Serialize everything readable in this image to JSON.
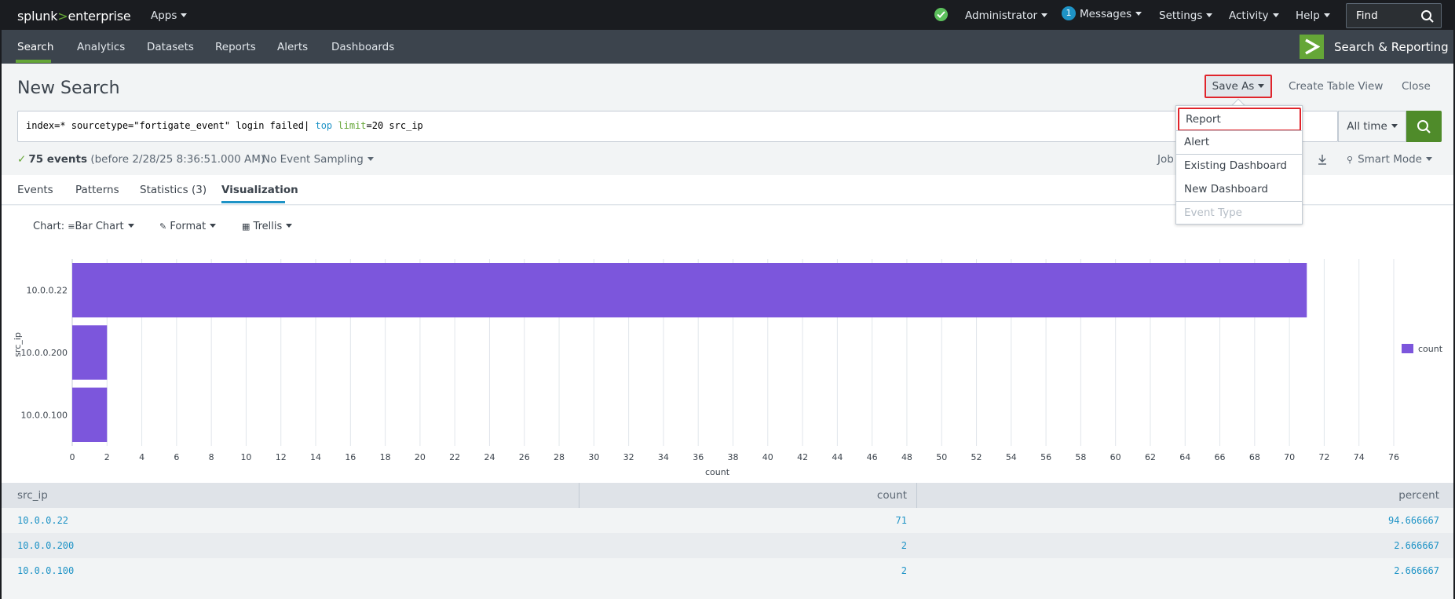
{
  "topbar": {
    "logo_splunk": "splunk",
    "logo_gt": ">",
    "logo_enterprise": "enterprise",
    "apps": "Apps",
    "admin": "Administrator",
    "messages_count": "1",
    "messages": "Messages",
    "settings": "Settings",
    "activity": "Activity",
    "help": "Help",
    "find_placeholder": "Find"
  },
  "appbar": {
    "items": [
      "Search",
      "Analytics",
      "Datasets",
      "Reports",
      "Alerts",
      "Dashboards"
    ],
    "app_title": "Search & Reporting"
  },
  "header": {
    "title": "New Search",
    "save_as": "Save As",
    "create_table_view": "Create Table View",
    "close": "Close"
  },
  "search": {
    "q_part1": "index=* sourcetype=\"fortigate_event\" login failed| ",
    "q_cmd": "top",
    "q_space": " ",
    "q_arg": "limit",
    "q_rest": "=20 src_ip",
    "time_range": "All time"
  },
  "status": {
    "events": "75 events",
    "before": "(before 2/28/25 8:36:51.000 AM)",
    "sampling": "No Event Sampling",
    "job": "Job",
    "mode": "Smart Mode"
  },
  "tabs": [
    "Events",
    "Patterns",
    "Statistics (3)",
    "Visualization"
  ],
  "chart_controls": {
    "chart_label": "Chart:",
    "chart_type": "Bar Chart",
    "format": "Format",
    "trellis": "Trellis"
  },
  "dropdown": {
    "items": [
      "Report",
      "Alert",
      "Existing Dashboard",
      "New Dashboard",
      "Event Type"
    ]
  },
  "chart_data": {
    "type": "bar",
    "orientation": "horizontal",
    "categories": [
      "10.0.0.22",
      "10.0.0.200",
      "10.0.0.100"
    ],
    "series": [
      {
        "name": "count",
        "values": [
          71,
          2,
          2
        ]
      }
    ],
    "xlabel": "count",
    "ylabel": "src_ip",
    "xlim": [
      0,
      76
    ],
    "xticks": [
      0,
      2,
      4,
      6,
      8,
      10,
      12,
      14,
      16,
      18,
      20,
      22,
      24,
      26,
      28,
      30,
      32,
      34,
      36,
      38,
      40,
      42,
      44,
      46,
      48,
      50,
      52,
      54,
      56,
      58,
      60,
      62,
      64,
      66,
      68,
      70,
      72,
      74,
      76
    ],
    "color": "#7c56dc",
    "grid": true,
    "legend": "right"
  },
  "table": {
    "headers": [
      "src_ip",
      "count",
      "percent"
    ],
    "rows": [
      [
        "10.0.0.22",
        "71",
        "94.666667"
      ],
      [
        "10.0.0.200",
        "2",
        "2.666667"
      ],
      [
        "10.0.0.100",
        "2",
        "2.666667"
      ]
    ]
  }
}
